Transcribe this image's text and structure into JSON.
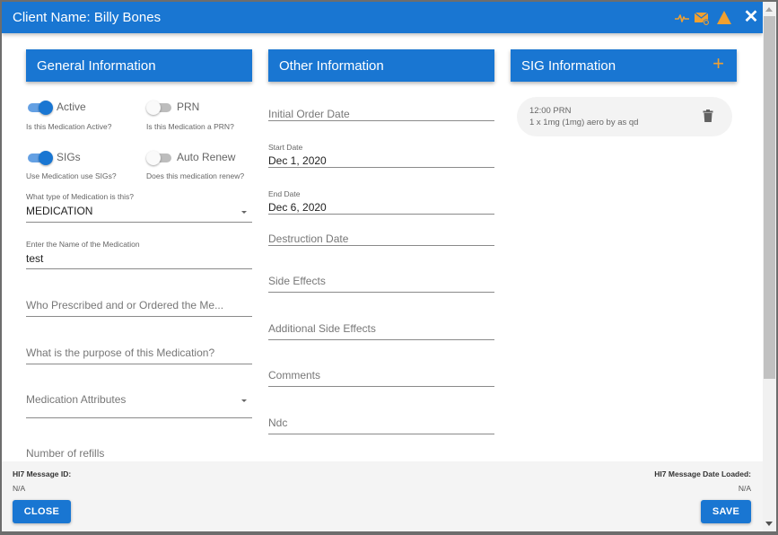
{
  "window": {
    "title": "Client Name: Billy Bones",
    "icons": [
      "pulse-icon",
      "mail-sync-icon",
      "warning-icon",
      "close-icon"
    ],
    "close_glyph": "✕",
    "icon_color": "#f0a030",
    "accent_color": "#1976d2"
  },
  "general": {
    "header": "General Information",
    "toggles": [
      {
        "label": "Active",
        "hint": "Is this Medication Active?",
        "on": true
      },
      {
        "label": "PRN",
        "hint": "Is this Medication a PRN?",
        "on": false
      },
      {
        "label": "SIGs",
        "hint": "Use Medication use SIGs?",
        "on": true
      },
      {
        "label": "Auto Renew",
        "hint": "Does this medication renew?",
        "on": false
      }
    ],
    "medication_type": {
      "label": "What type of Medication is this?",
      "value": "MEDICATION"
    },
    "medication_name": {
      "label": "Enter the Name of the Medication",
      "value": "test"
    },
    "prescribed_by": {
      "placeholder": "Who Prescribed and or Ordered the Me..."
    },
    "purpose": {
      "placeholder": "What is the purpose of this Medication?"
    },
    "attributes": {
      "placeholder": "Medication Attributes"
    },
    "refills": {
      "placeholder": "Number of refills"
    }
  },
  "other": {
    "header": "Other Information",
    "initial_order_date": {
      "placeholder": "Initial Order Date"
    },
    "start_date": {
      "label": "Start Date",
      "value": "Dec 1, 2020"
    },
    "end_date": {
      "label": "End Date",
      "value": "Dec 6, 2020"
    },
    "destruction_date": {
      "placeholder": "Destruction Date"
    },
    "side_effects": {
      "placeholder": "Side Effects"
    },
    "additional_side_effects": {
      "placeholder": "Additional Side Effects"
    },
    "comments": {
      "placeholder": "Comments"
    },
    "ndc": {
      "placeholder": "Ndc"
    }
  },
  "sig": {
    "header": "SIG Information",
    "add_glyph": "+",
    "items": [
      {
        "time": "12:00 PRN",
        "description": "1 x 1mg (1mg) aero by as qd"
      }
    ]
  },
  "footer": {
    "message_id_label": "HI7 Message ID:",
    "message_id_value": "N/A",
    "date_loaded_label": "HI7 Message Date Loaded:",
    "date_loaded_value": "N/A",
    "close_label": "CLOSE",
    "save_label": "SAVE"
  }
}
